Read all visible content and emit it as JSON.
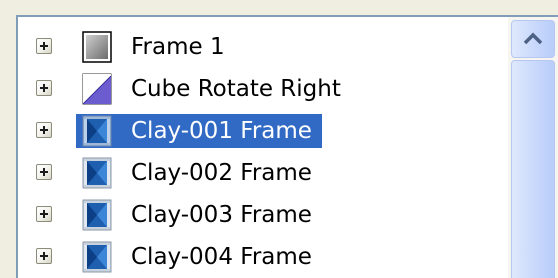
{
  "tree": {
    "items": [
      {
        "label": "Frame 1",
        "icon": "gray-square-frame-icon",
        "selected": false
      },
      {
        "label": "Cube Rotate Right",
        "icon": "diagonal-transition-icon",
        "selected": false
      },
      {
        "label": "Clay-001 Frame",
        "icon": "blue-film-frame-icon",
        "selected": true
      },
      {
        "label": "Clay-002 Frame",
        "icon": "blue-film-frame-icon",
        "selected": false
      },
      {
        "label": "Clay-003 Frame",
        "icon": "blue-film-frame-icon",
        "selected": false
      },
      {
        "label": "Clay-004 Frame",
        "icon": "blue-film-frame-icon",
        "selected": false
      }
    ]
  },
  "colors": {
    "selection": "#316ac5",
    "border": "#7f9db9",
    "scrollbar": "#c7d7fb",
    "window_bg": "#f0eee0"
  }
}
